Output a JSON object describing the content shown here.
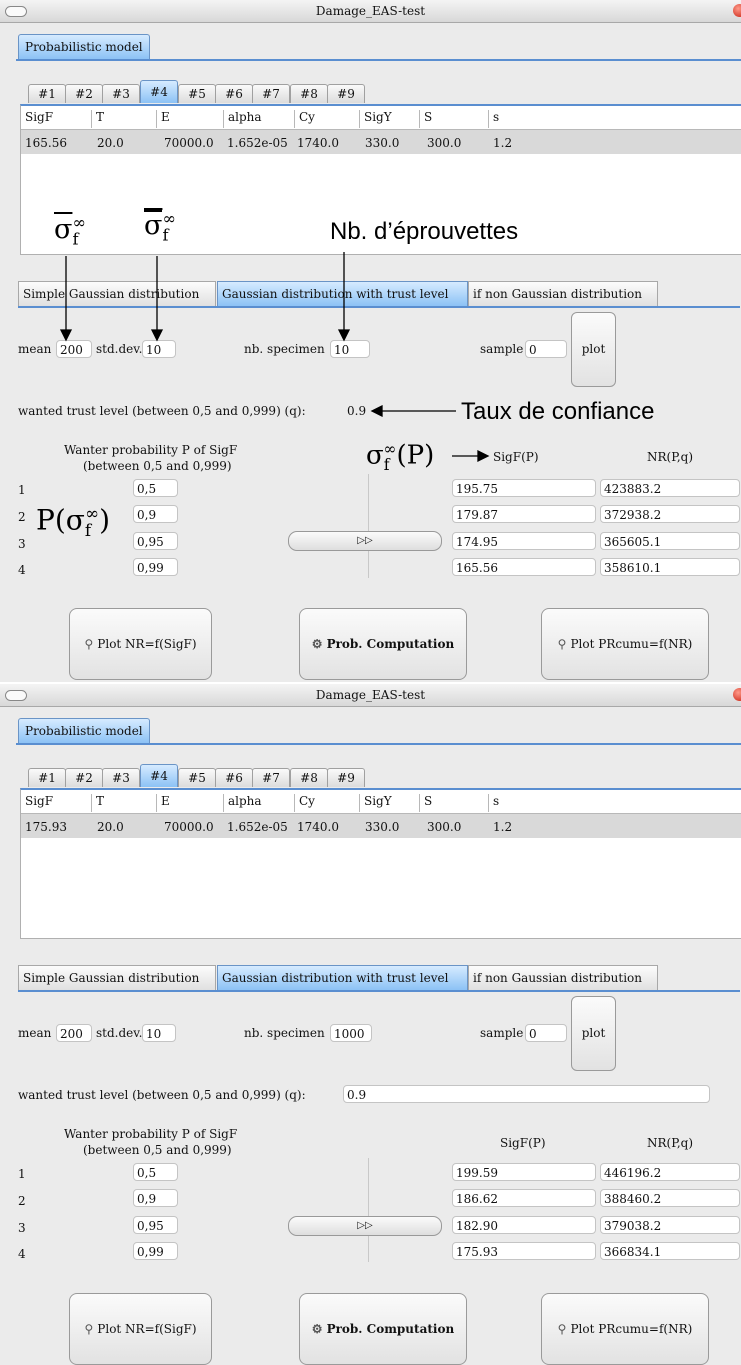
{
  "window_title": "Damage_EAS-test",
  "main_tab": "Probabilistic model",
  "number_tabs": [
    "#1",
    "#2",
    "#3",
    "#4",
    "#5",
    "#6",
    "#7",
    "#8",
    "#9"
  ],
  "table_headers": [
    "SigF",
    "T",
    "E",
    "alpha",
    "Cy",
    "SigY",
    "S",
    "s"
  ],
  "dist_tabs": [
    "Simple Gaussian distribution",
    "Gaussian distribution with trust level",
    "if non Gaussian distribution"
  ],
  "labels": {
    "mean": "mean",
    "std": "std.dev.",
    "nb_specimen": "nb. specimen",
    "sample": "sample",
    "plot": "plot",
    "trust": "wanted trust level (between 0,5 and 0,999) (q):",
    "wanted_prob_line1": "Wanter probability P of SigF",
    "wanted_prob_line2": "(between 0,5 and 0,999)",
    "col_sigf": "SigF(P)",
    "col_nr": "NR(P,q)",
    "row_idx": [
      "1",
      "2",
      "3",
      "4"
    ],
    "btn_plot_nr": "Plot NR=f(SigF)",
    "btn_prob": "Prob. Computation",
    "btn_plot_pr": "Plot PRcumu=f(NR)"
  },
  "annotations": {
    "nb_eprouvettes": "Nb. d’éprouvettes",
    "taux": "Taux de confiance"
  },
  "windows": [
    {
      "row": [
        "165.56",
        "20.0",
        "70000.0",
        "1.652e-05",
        "1740.0",
        "330.0",
        "300.0",
        "1.2"
      ],
      "mean": "200",
      "std": "10",
      "nb_specimen": "10",
      "sample": "0",
      "trust": "0.9",
      "probs": [
        "0,5",
        "0,9",
        "0,95",
        "0,99"
      ],
      "sigf": [
        "195.75",
        "179.87",
        "174.95",
        "165.56"
      ],
      "nr": [
        "423883.2",
        "372938.2",
        "365605.1",
        "358610.1"
      ]
    },
    {
      "row": [
        "175.93",
        "20.0",
        "70000.0",
        "1.652e-05",
        "1740.0",
        "330.0",
        "300.0",
        "1.2"
      ],
      "mean": "200",
      "std": "10",
      "nb_specimen": "1000",
      "sample": "0",
      "trust": "0.9",
      "probs": [
        "0,5",
        "0,9",
        "0,95",
        "0,99"
      ],
      "sigf": [
        "199.59",
        "186.62",
        "182.90",
        "175.93"
      ],
      "nr": [
        "446196.2",
        "388460.2",
        "379038.2",
        "366834.1"
      ]
    }
  ]
}
